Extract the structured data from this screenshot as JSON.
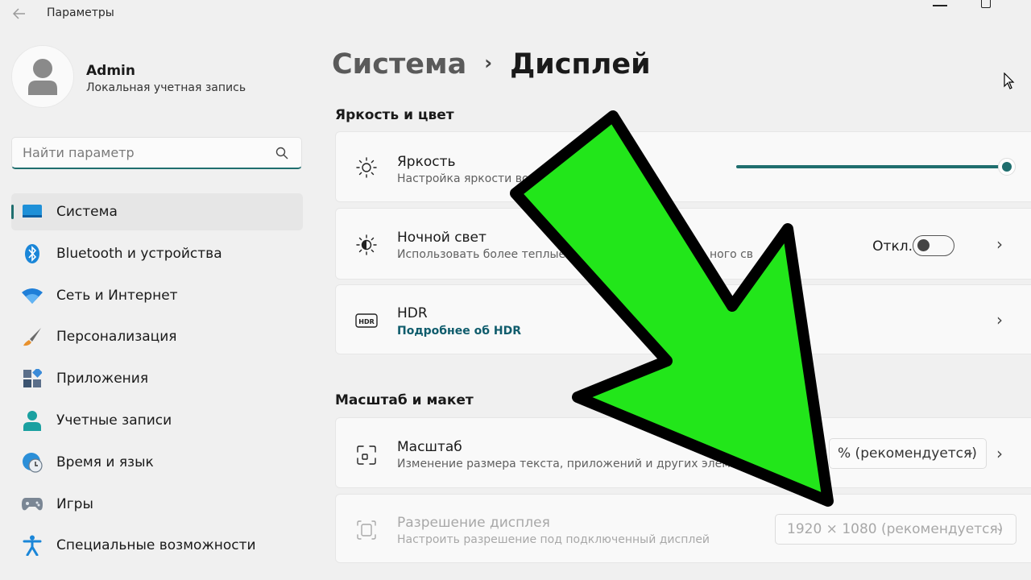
{
  "window": {
    "title": "Параметры"
  },
  "profile": {
    "name": "Admin",
    "account_type": "Локальная учетная запись"
  },
  "search": {
    "placeholder": "Найти параметр"
  },
  "sidebar": {
    "items": [
      {
        "label": "Система",
        "icon": "system-icon",
        "active": true
      },
      {
        "label": "Bluetooth и устройства",
        "icon": "bluetooth-icon"
      },
      {
        "label": "Сеть и Интернет",
        "icon": "wifi-icon"
      },
      {
        "label": "Персонализация",
        "icon": "brush-icon"
      },
      {
        "label": "Приложения",
        "icon": "apps-icon"
      },
      {
        "label": "Учетные записи",
        "icon": "account-icon"
      },
      {
        "label": "Время и язык",
        "icon": "clock-globe-icon"
      },
      {
        "label": "Игры",
        "icon": "gamepad-icon"
      },
      {
        "label": "Специальные возможности",
        "icon": "accessibility-icon"
      }
    ]
  },
  "breadcrumb": {
    "parent": "Система",
    "separator": "›",
    "current": "Дисплей"
  },
  "sections": {
    "brightness_color": "Яркость и цвет",
    "scale_layout": "Масштаб и макет"
  },
  "brightness": {
    "title": "Яркость",
    "subtitle": "Настройка яркости во",
    "level": 1.0
  },
  "night_light": {
    "title": "Ночной свет",
    "subtitle": "Использовать более теплые",
    "subtitle_tail": "ного св",
    "state_label": "Откл.",
    "on": false
  },
  "hdr": {
    "title": "HDR",
    "link": "Подробнее об HDR"
  },
  "scale": {
    "title": "Масштаб",
    "subtitle": "Изменение размера текста, приложений и других элеме",
    "value": "% (рекомендуется)"
  },
  "resolution": {
    "title": "Разрешение дисплея",
    "subtitle": "Настроить разрешение под подключенный дисплей",
    "value": "1920 × 1080 (рекомендуется)"
  },
  "colors": {
    "accent": "#1f6e6e",
    "arrow_fill": "#22e61a",
    "arrow_stroke": "#000000"
  }
}
